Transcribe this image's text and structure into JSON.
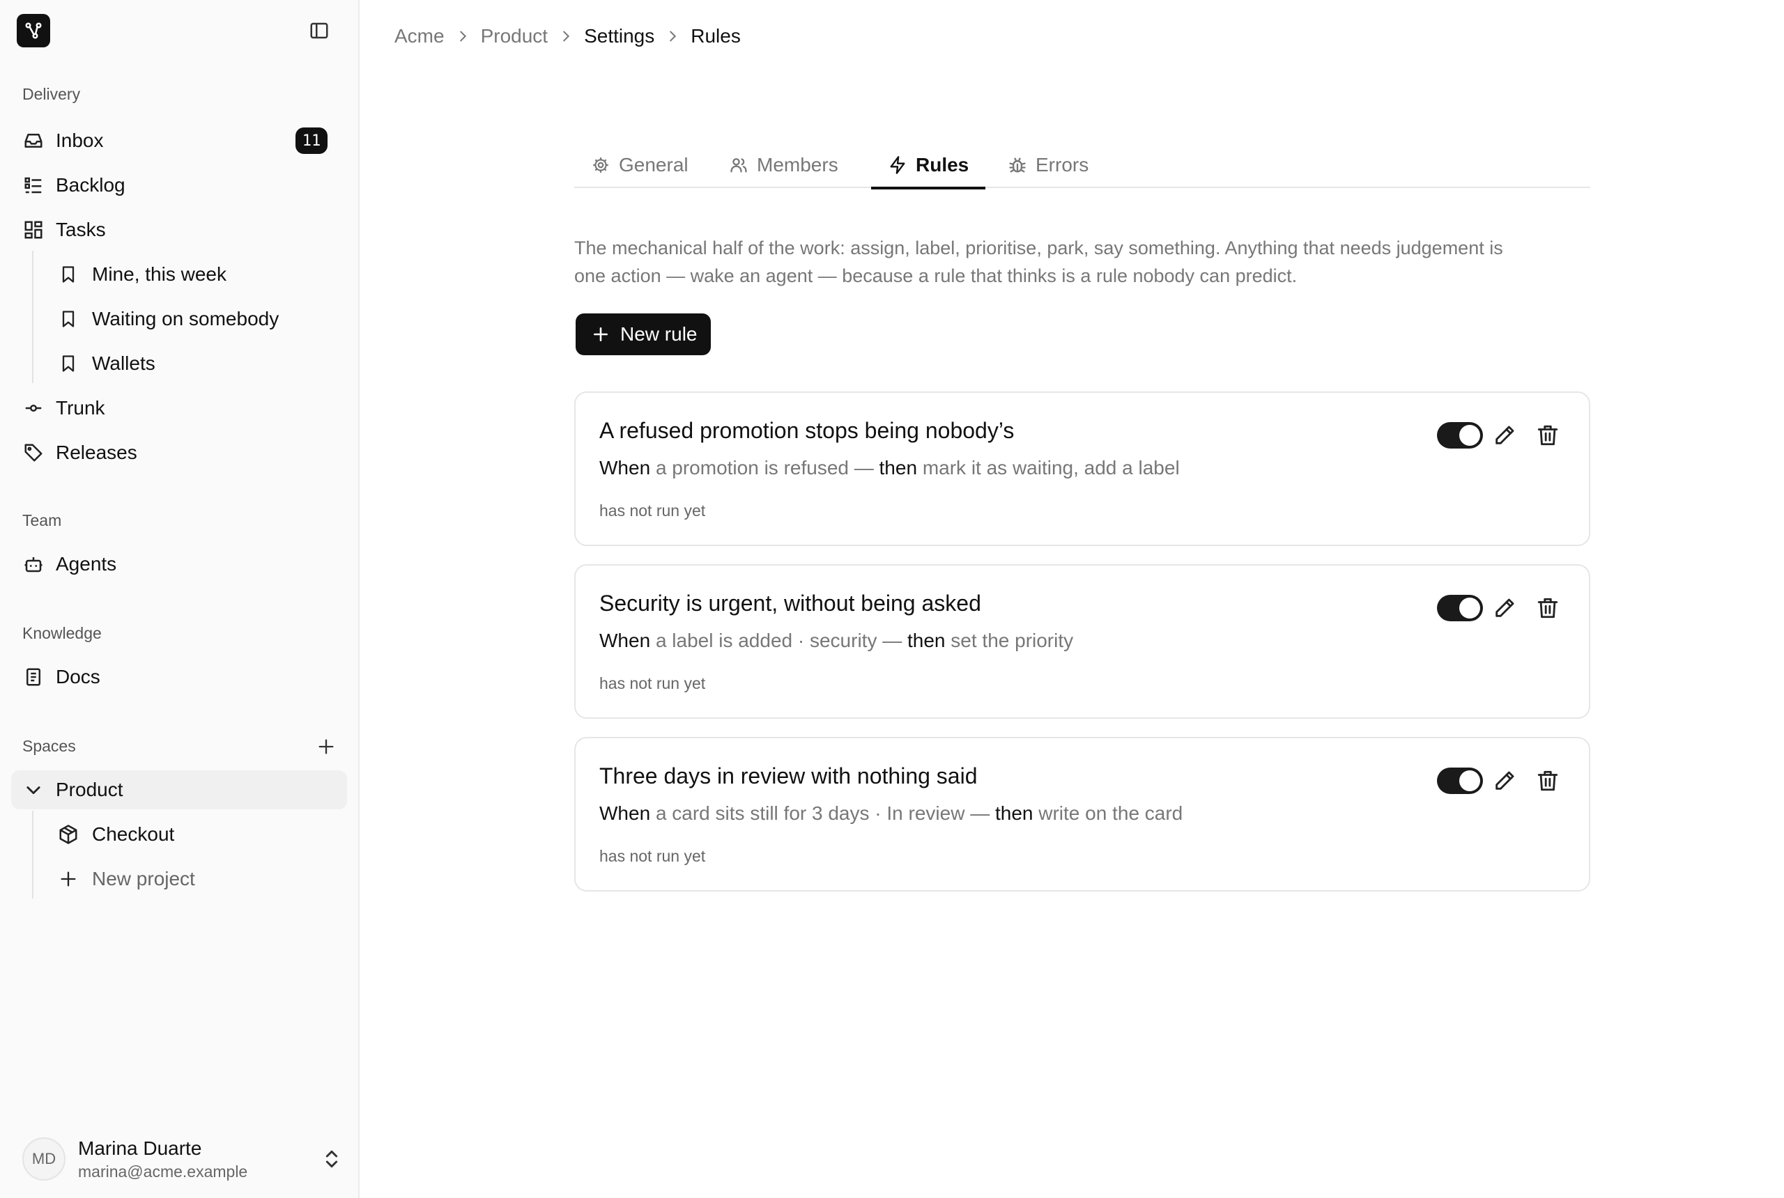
{
  "sidebar": {
    "sections": {
      "delivery": "Delivery",
      "team": "Team",
      "knowledge": "Knowledge",
      "spaces": "Spaces"
    },
    "inbox": {
      "label": "Inbox",
      "count": "11"
    },
    "backlog": "Backlog",
    "tasks": "Tasks",
    "views": [
      "Mine, this week",
      "Waiting on somebody",
      "Wallets"
    ],
    "trunk": "Trunk",
    "releases": "Releases",
    "agents": "Agents",
    "docs": "Docs",
    "space": {
      "name": "Product",
      "projects": [
        "Checkout"
      ],
      "new_project": "New project"
    },
    "user": {
      "initials": "MD",
      "name": "Marina Duarte",
      "email": "marina@acme.example"
    }
  },
  "breadcrumb": [
    "Acme",
    "Product",
    "Settings",
    "Rules"
  ],
  "tabs": [
    {
      "label": "General",
      "icon": "gear-icon"
    },
    {
      "label": "Members",
      "icon": "users-icon"
    },
    {
      "label": "Rules",
      "icon": "bolt-icon",
      "active": true
    },
    {
      "label": "Errors",
      "icon": "bug-icon"
    }
  ],
  "description": "The mechanical half of the work: assign, label, prioritise, park, say something. Anything that needs judgement is one action — wake an agent — because a rule that thinks is a rule nobody can predict.",
  "new_rule_label": "New rule",
  "rules": [
    {
      "title": "A refused promotion stops being nobody’s",
      "when_kw": "When",
      "trigger": "a promotion is refused —",
      "then_kw": "then",
      "action": "mark it as waiting, add a label",
      "status": "has not run yet",
      "enabled": true
    },
    {
      "title": "Security is urgent, without being asked",
      "when_kw": "When",
      "trigger": "a label is added · security —",
      "then_kw": "then",
      "action": "set the priority",
      "status": "has not run yet",
      "enabled": true
    },
    {
      "title": "Three days in review with nothing said",
      "when_kw": "When",
      "trigger": "a card sits still for 3 days · In review —",
      "then_kw": "then",
      "action": "write on the card",
      "status": "has not run yet",
      "enabled": true
    }
  ]
}
